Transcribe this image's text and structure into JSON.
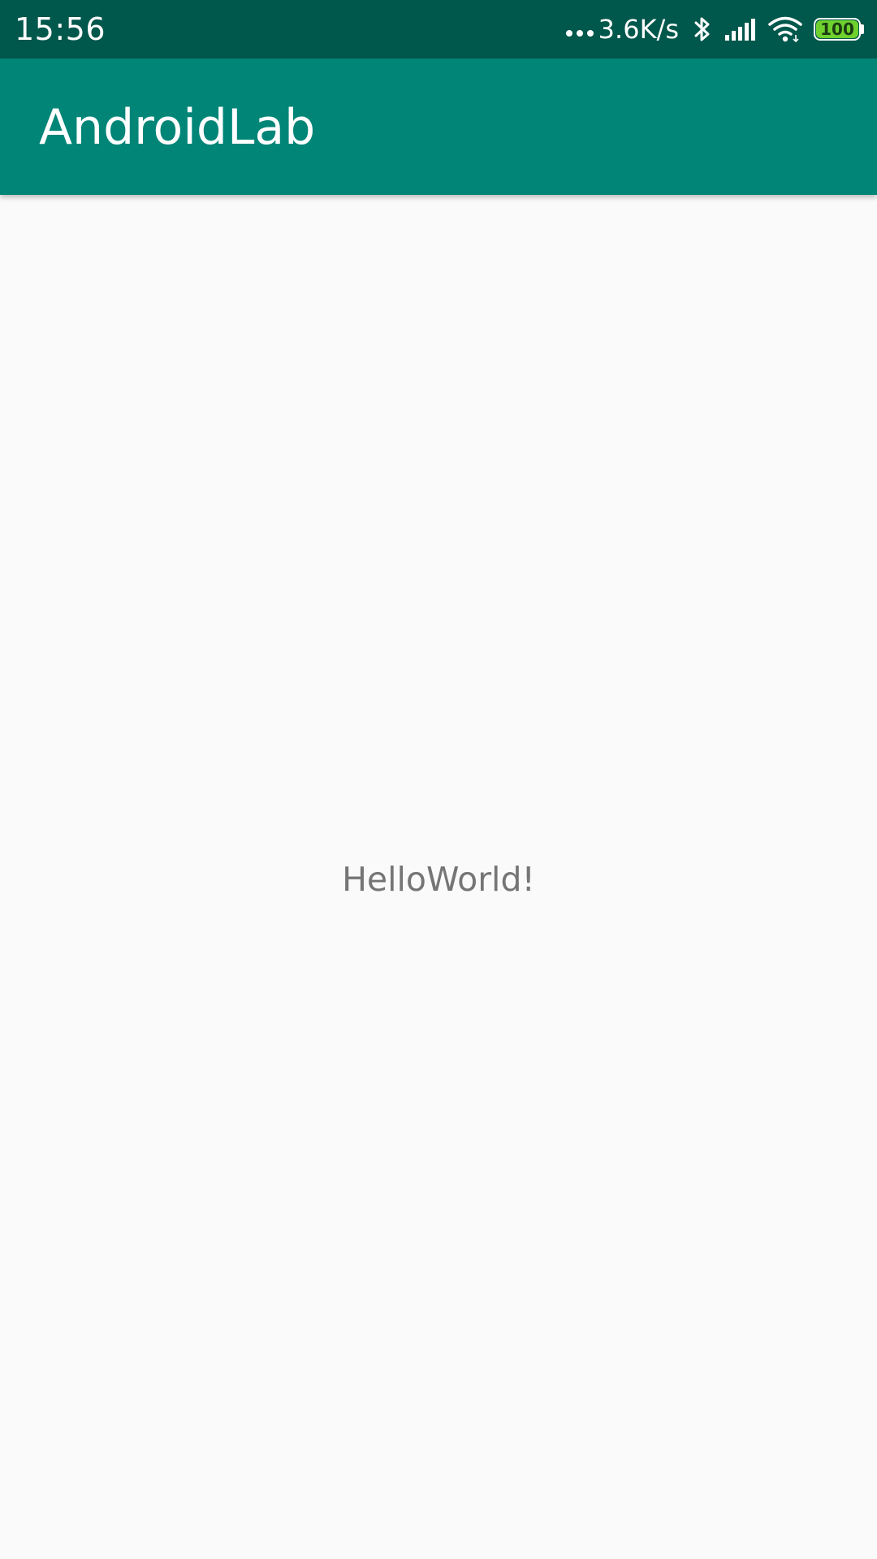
{
  "status_bar": {
    "time": "15:56",
    "net_speed": "3.6K/s",
    "battery_level": "100",
    "icons": [
      "more-dots-icon",
      "bluetooth-icon",
      "signal-icon",
      "wifi-icon",
      "battery-icon"
    ],
    "background_color": "#00574b"
  },
  "app_bar": {
    "title": "AndroidLab",
    "background_color": "#008577"
  },
  "main": {
    "message": "HelloWorld!",
    "text_color": "#757575",
    "background_color": "#fafafa"
  }
}
